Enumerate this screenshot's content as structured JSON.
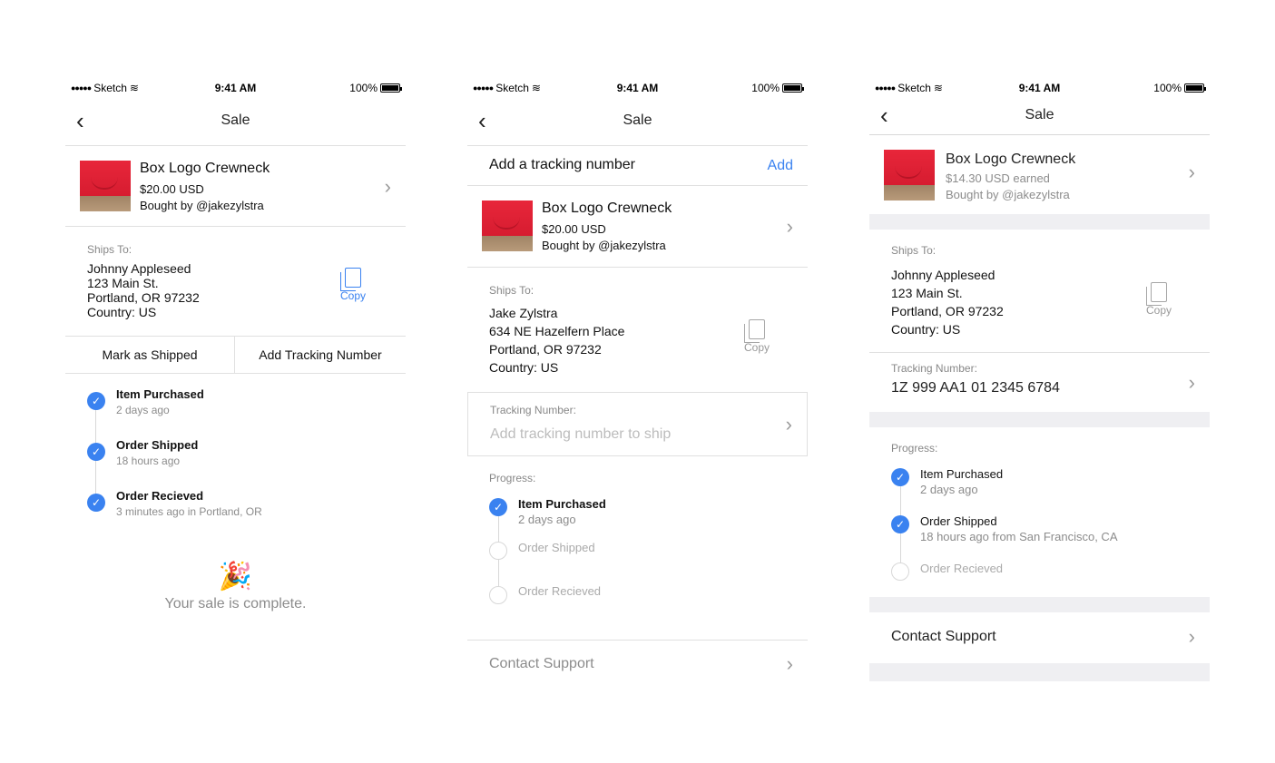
{
  "status_bar": {
    "carrier": "Sketch",
    "time": "9:41 AM",
    "battery": "100%"
  },
  "screen1": {
    "nav_title": "Sale",
    "product": {
      "name": "Box Logo Crewneck",
      "price": "$20.00 USD",
      "buyer": "Bought by @jakezylstra"
    },
    "ships_to": {
      "label": "Ships To:",
      "lines": [
        "Johnny Appleseed",
        "123 Main St.",
        "Portland, OR 97232",
        "Country: US"
      ]
    },
    "copy_label": "Copy",
    "actions": {
      "mark_shipped": "Mark as Shipped",
      "add_tracking": "Add Tracking Number"
    },
    "steps": [
      {
        "title": "Item Purchased",
        "sub": "2 days ago"
      },
      {
        "title": "Order Shipped",
        "sub": "18 hours ago"
      },
      {
        "title": "Order Recieved",
        "sub": "3 minutes ago in Portland, OR"
      }
    ],
    "party_emoji": "🎉",
    "complete_text": "Your sale is complete."
  },
  "screen2": {
    "nav_title": "Sale",
    "tracking_banner": {
      "text": "Add a tracking number",
      "action": "Add"
    },
    "product": {
      "name": "Box Logo Crewneck",
      "price": "$20.00 USD",
      "buyer": "Bought by @jakezylstra"
    },
    "ships_to": {
      "label": "Ships To:",
      "lines": [
        "Jake Zylstra",
        "634 NE Hazelfern Place",
        "Portland, OR 97232",
        "Country: US"
      ]
    },
    "copy_label": "Copy",
    "tracking": {
      "label": "Tracking Number:",
      "placeholder": "Add tracking number to ship"
    },
    "progress_label": "Progress:",
    "steps": [
      {
        "title": "Item Purchased",
        "sub": "2 days ago",
        "done": true
      },
      {
        "title": "Order Shipped",
        "sub": "",
        "done": false
      },
      {
        "title": "Order Recieved",
        "sub": "",
        "done": false
      }
    ],
    "contact": "Contact Support"
  },
  "screen3": {
    "nav_title": "Sale",
    "product": {
      "name": "Box Logo Crewneck",
      "price": "$14.30 USD earned",
      "buyer": "Bought by @jakezylstra"
    },
    "ships_to": {
      "label": "Ships To:",
      "lines": [
        "Johnny Appleseed",
        "123 Main St.",
        "Portland, OR 97232",
        "Country: US"
      ]
    },
    "copy_label": "Copy",
    "tracking": {
      "label": "Tracking Number:",
      "value": "1Z 999 AA1 01 2345 6784"
    },
    "progress_label": "Progress:",
    "steps": [
      {
        "title": "Item Purchased",
        "sub": "2 days ago",
        "done": true
      },
      {
        "title": "Order Shipped",
        "sub": "18 hours ago from San Francisco, CA",
        "done": true
      },
      {
        "title": "Order Recieved",
        "sub": "",
        "done": false
      }
    ],
    "contact": "Contact Support"
  },
  "colors": {
    "accent": "#3a82f0",
    "divider": "#e0e0e0",
    "section_gray": "#efeff2"
  }
}
